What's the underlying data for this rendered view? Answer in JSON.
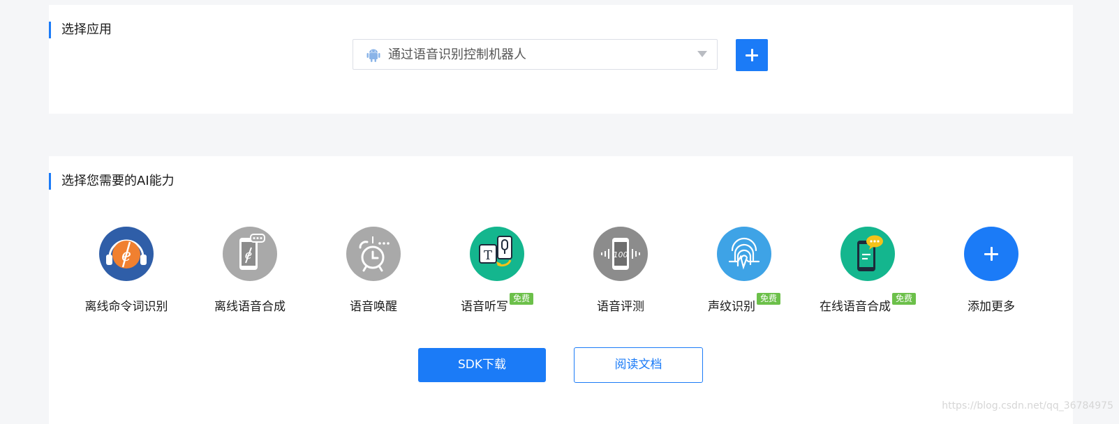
{
  "select_app": {
    "title": "选择应用",
    "selected_value": "通过语音识别控制机器人",
    "add_button_icon": "plus-icon",
    "platform_icon": "android-icon"
  },
  "ability_section": {
    "title": "选择您需要的AI能力",
    "items": [
      {
        "label": "离线命令词识别",
        "icon": "offline-command-icon",
        "badge": ""
      },
      {
        "label": "离线语音合成",
        "icon": "offline-tts-icon",
        "badge": ""
      },
      {
        "label": "语音唤醒",
        "icon": "wake-alarm-icon",
        "badge": ""
      },
      {
        "label": "语音听写",
        "icon": "dictation-icon",
        "badge": "免费"
      },
      {
        "label": "语音评测",
        "icon": "evaluation-icon",
        "badge": ""
      },
      {
        "label": "声纹识别",
        "icon": "fingerprint-icon",
        "badge": "免费"
      },
      {
        "label": "在线语音合成",
        "icon": "online-tts-icon",
        "badge": "免费"
      },
      {
        "label": "添加更多",
        "icon": "plus-icon",
        "badge": ""
      }
    ]
  },
  "actions": {
    "sdk_download": "SDK下载",
    "read_docs": "阅读文档"
  },
  "watermark": "https://blog.csdn.net/qq_36784975",
  "colors": {
    "primary": "#1b7bf7",
    "free_badge": "#6cc04a",
    "page_bg": "#f5f6f8"
  }
}
